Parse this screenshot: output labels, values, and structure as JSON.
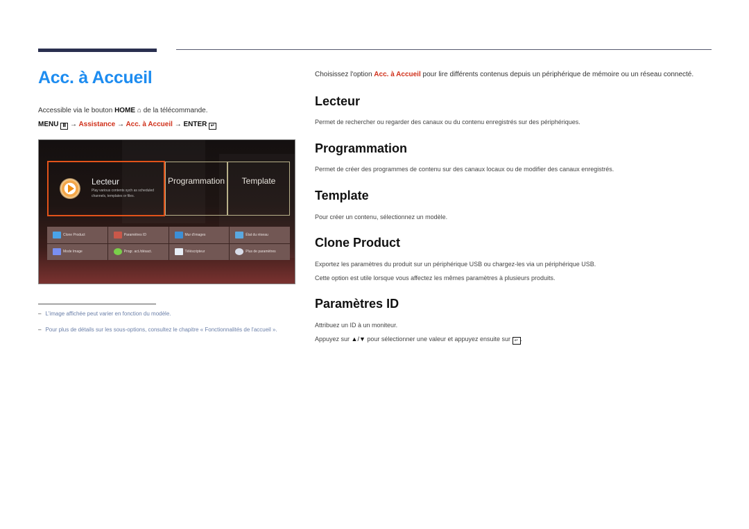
{
  "header": {
    "title": "Acc. à Accueil",
    "access_prefix": "Accessible via le bouton",
    "access_button": "HOME",
    "access_suffix": "de la télécommande.",
    "home_icon": "⌂",
    "menu_path": {
      "menu": "MENU",
      "menu_icon": "Ⅲ",
      "arrow": "→",
      "assistance": "Assistance",
      "acc": "Acc. à Accueil",
      "enter": "ENTER",
      "enter_icon": "↵"
    }
  },
  "screenshot": {
    "tiles": {
      "main": {
        "title": "Lecteur",
        "description": "Play various contents sych as scheduled channels, templates or files."
      },
      "programmation": "Programmation",
      "template": "Template"
    },
    "grid": [
      {
        "label": "Clone Product",
        "icon": "clone-product-icon",
        "color": "#4aa3e8"
      },
      {
        "label": "Paramètres ID",
        "icon": "id-card-icon",
        "color": "#c9584a"
      },
      {
        "label": "Mur d'images",
        "icon": "video-wall-icon",
        "color": "#3c8fd6"
      },
      {
        "label": "État du réseau",
        "icon": "network-status-icon",
        "color": "#5aa8e0"
      },
      {
        "label": "Mode Image",
        "icon": "picture-mode-icon",
        "color": "#7a8ff0"
      },
      {
        "label": "Progr. act./désact.",
        "icon": "on-off-timer-icon",
        "color": "#7ad04a"
      },
      {
        "label": "Téléscripteur",
        "icon": "ticker-icon",
        "color": "#e8eef6"
      },
      {
        "label": "Plus de paramètres",
        "icon": "gear-icon",
        "color": "#d8dce8"
      }
    ]
  },
  "notes": [
    "L'image affichée peut varier en fonction du modèle.",
    "Pour plus de détails sur les sous-options, consultez le chapitre « Fonctionnalités de l'accueil »."
  ],
  "note_dash": "–",
  "intro": {
    "prefix": "Choisissez l'option",
    "highlight": "Acc. à Accueil",
    "suffix": "pour lire différents contenus depuis un périphérique de mémoire ou un réseau connecté."
  },
  "sections": [
    {
      "title": "Lecteur",
      "paragraphs": [
        "Permet de rechercher ou regarder des canaux ou du contenu enregistrés sur des périphériques."
      ]
    },
    {
      "title": "Programmation",
      "paragraphs": [
        "Permet de créer des programmes de contenu sur des canaux locaux ou de modifier des canaux enregistrés."
      ]
    },
    {
      "title": "Template",
      "paragraphs": [
        "Pour créer un contenu, sélectionnez un modèle."
      ]
    },
    {
      "title": "Clone Product",
      "paragraphs": [
        "Exportez les paramètres du produit sur un périphérique USB ou chargez-les via un périphérique USB.",
        "Cette option est utile lorsque vous affectez les mêmes paramètres à plusieurs produits."
      ]
    },
    {
      "title": "Paramètres ID",
      "paragraphs": [
        "Attribuez un ID à un moniteur."
      ],
      "last_line": {
        "prefix": "Appuyez sur",
        "arrows": "▲/▼",
        "middle": "pour sélectionner une valeur et appuyez ensuite sur",
        "enter_icon": "↵",
        "end": "."
      }
    }
  ]
}
